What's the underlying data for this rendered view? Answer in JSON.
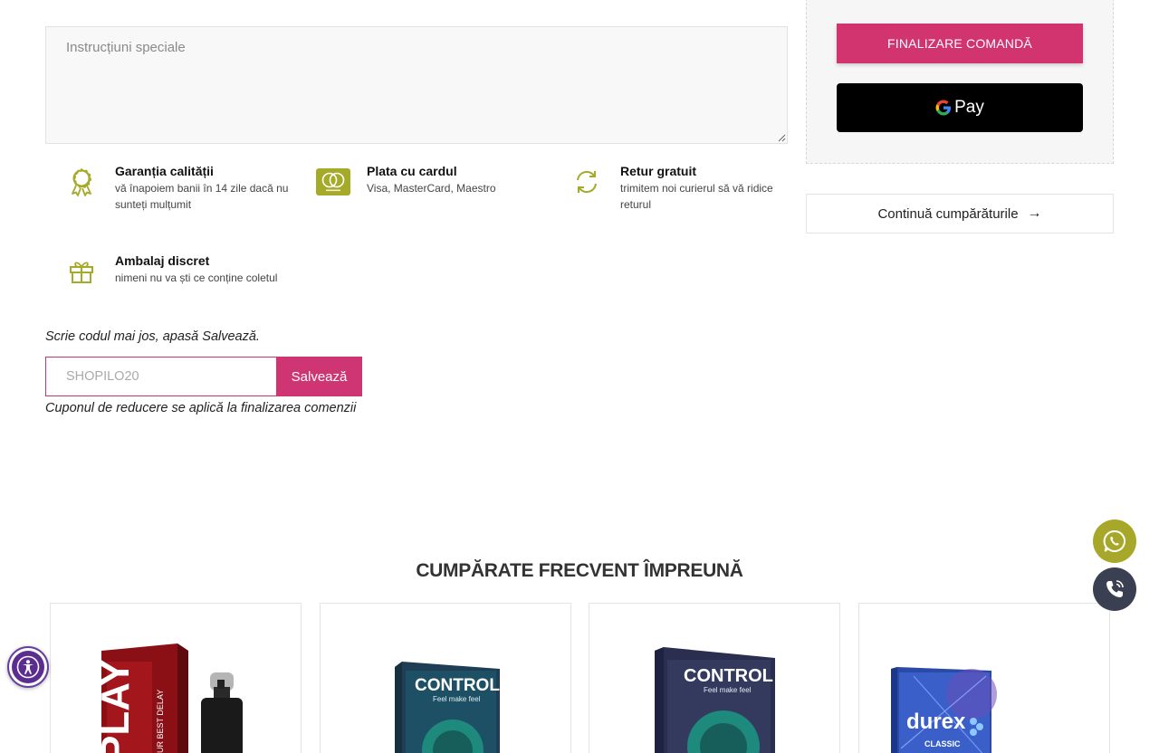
{
  "notes": {
    "placeholder": "Instrucțiuni speciale"
  },
  "features": [
    {
      "icon": "award-ribbon-icon",
      "title": "Garanția calității",
      "desc": "vă înapoiem banii în 14 zile dacă nu sunteți mulțumit"
    },
    {
      "icon": "mastercard-icon",
      "title": "Plata cu cardul",
      "desc": "Visa, MasterCard, Maestro"
    },
    {
      "icon": "refresh-arrows-icon",
      "title": "Retur gratuit",
      "desc": "trimitem noi curierul să vă ridice returul"
    },
    {
      "icon": "gift-box-icon",
      "title": "Ambalaj discret",
      "desc": "nimeni nu va ști ce conține coletul"
    }
  ],
  "coupon": {
    "hint": "Scrie codul mai jos, apasă Salvează.",
    "placeholder": "SHOPILO20",
    "button": "Salvează",
    "note": "Cuponul de reducere se aplică la finalizarea comenzii"
  },
  "summary": {
    "checkout_label": "FINALIZARE COMANDĂ",
    "gpay_label": "Pay",
    "continue_label": "Continuă cumpărăturile",
    "accent": "#d23470"
  },
  "related": {
    "title": "CUMPĂRATE FRECVENT ÎMPREUNĂ",
    "products": [
      {
        "brand": "PLAY",
        "tag": "YOUR BEST DELAY"
      },
      {
        "brand": "CONTROL",
        "tag": "Feel make feel"
      },
      {
        "brand": "CONTROL",
        "tag": "Feel make feel"
      },
      {
        "brand": "durex",
        "tag": "CLASSIC"
      }
    ]
  },
  "floating": {
    "whatsapp_icon": "whatsapp-icon",
    "phone_icon": "phone-call-icon",
    "accessibility_icon": "accessibility-icon"
  }
}
